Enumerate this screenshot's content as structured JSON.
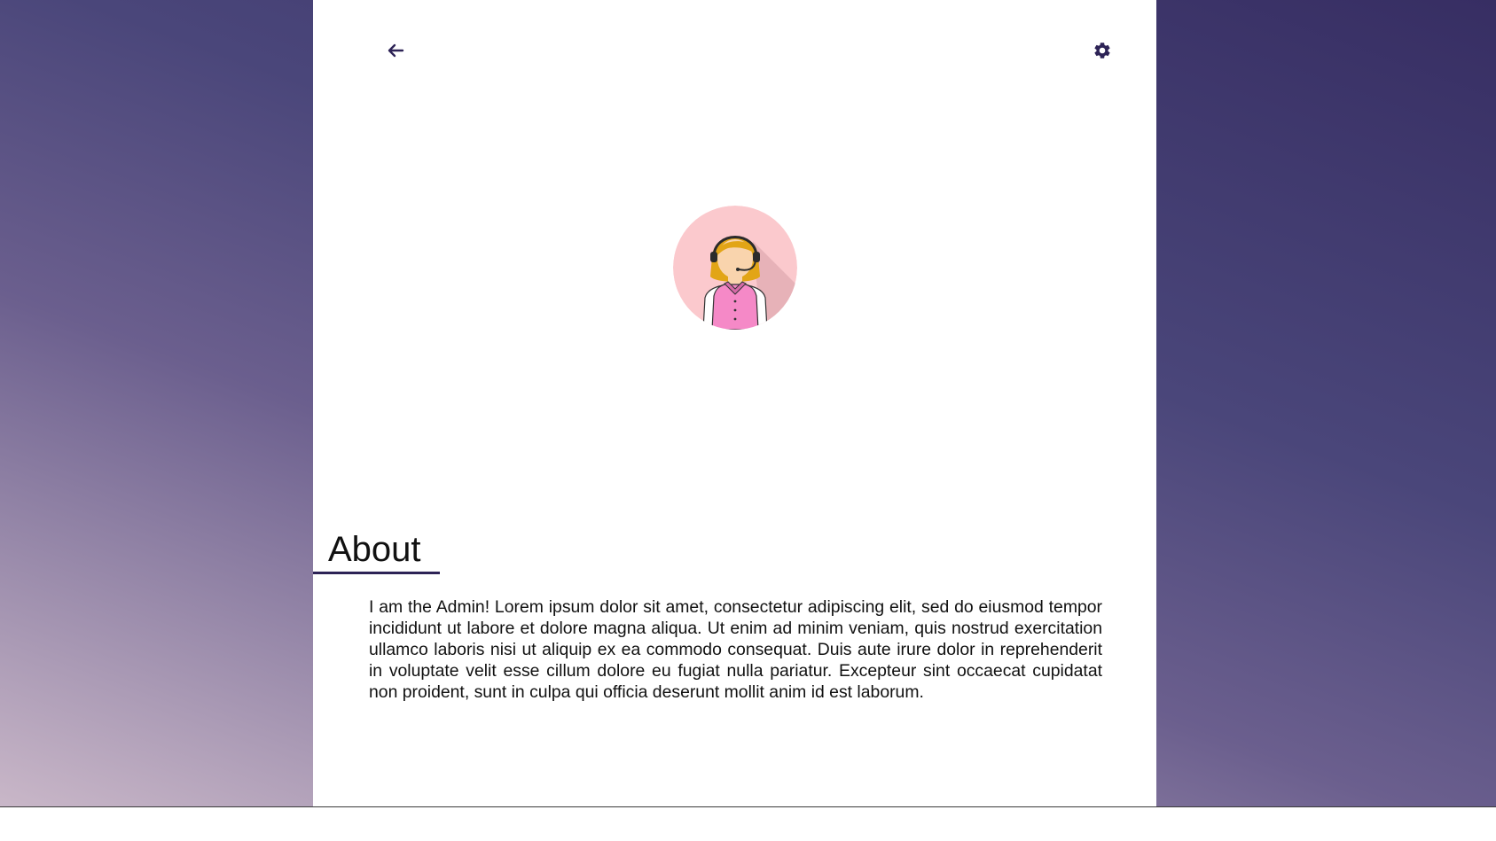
{
  "nav": {
    "back_icon": "arrow-left-icon",
    "settings_icon": "gear-icon"
  },
  "profile": {
    "avatar_icon": "support-agent-avatar"
  },
  "about": {
    "heading": "About",
    "text": "I am the Admin! Lorem ipsum dolor sit amet, consectetur adipiscing elit, sed do eiusmod tempor incididunt ut labore et dolore magna aliqua. Ut enim ad minim veniam, quis nostrud exercitation ullamco laboris nisi ut aliquip ex ea commodo consequat. Duis aute irure dolor in reprehenderit in voluptate velit esse cillum dolore eu fugiat nulla pariatur. Excepteur sint occaecat cupidatat non proident, sunt in culpa qui officia deserunt mollit anim id est laborum."
  },
  "colors": {
    "accent": "#2d2356",
    "gradient_dark": "#372e63",
    "gradient_light": "#c9b7c8",
    "panel": "#ffffff"
  }
}
